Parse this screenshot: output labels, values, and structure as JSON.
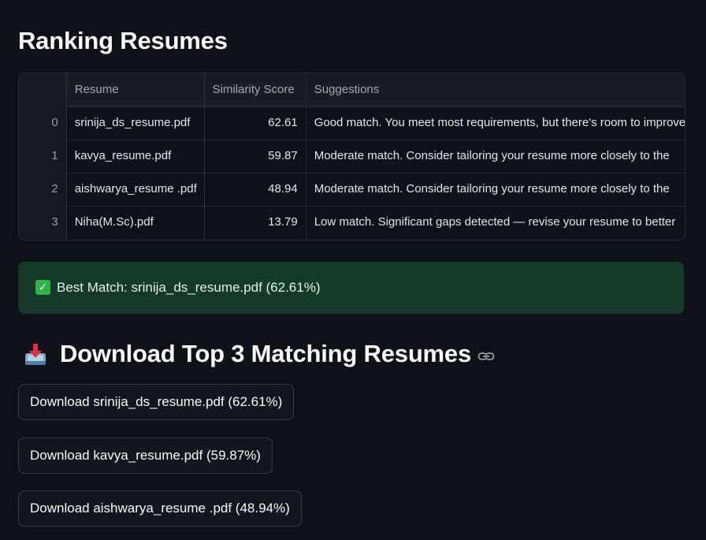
{
  "page": {
    "title": "Ranking Resumes"
  },
  "table": {
    "columns": [
      "",
      "Resume",
      "Similarity Score",
      "Suggestions"
    ],
    "rows": [
      {
        "index": "0",
        "resume": "srinija_ds_resume.pdf",
        "score": "62.61",
        "suggestion": "Good match. You meet most requirements, but there's room to improve"
      },
      {
        "index": "1",
        "resume": "kavya_resume.pdf",
        "score": "59.87",
        "suggestion": "Moderate match. Consider tailoring your resume more closely to the"
      },
      {
        "index": "2",
        "resume": "aishwarya_resume .pdf",
        "score": "48.94",
        "suggestion": "Moderate match. Consider tailoring your resume more closely to the"
      },
      {
        "index": "3",
        "resume": "Niha(M.Sc).pdf",
        "score": "13.79",
        "suggestion": "Low match. Significant gaps detected — revise your resume to better"
      }
    ]
  },
  "best_match": {
    "icon": "check-icon",
    "text": "Best Match: srinija_ds_resume.pdf (62.61%)"
  },
  "download_section": {
    "icon": "inbox-tray-icon",
    "title": "Download Top 3 Matching Resumes",
    "buttons": [
      "Download srinija_ds_resume.pdf (62.61%)",
      "Download kavya_resume.pdf (59.87%)",
      "Download aishwarya_resume .pdf (48.94%)"
    ]
  },
  "colors": {
    "background": "#0e1117",
    "success_bg": "#173928",
    "text": "#fafafa"
  }
}
